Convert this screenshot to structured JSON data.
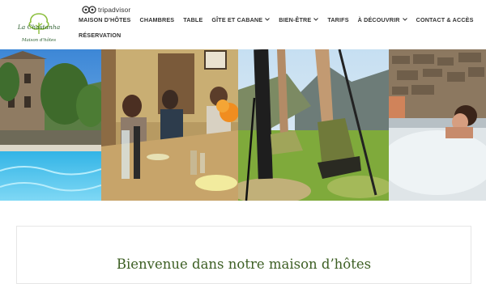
{
  "brand": {
    "name": "La Chastanha",
    "subtitle": "Maison d'hôtes"
  },
  "tripadvisor": {
    "label": "tripadvisor"
  },
  "nav": {
    "items": [
      {
        "label": "MAISON D'HÔTES",
        "dropdown": false
      },
      {
        "label": "CHAMBRES",
        "dropdown": false
      },
      {
        "label": "TABLE",
        "dropdown": false
      },
      {
        "label": "GÎTE ET CABANE",
        "dropdown": true
      },
      {
        "label": "BIEN-ÊTRE",
        "dropdown": true
      },
      {
        "label": "TARIFS",
        "dropdown": false
      },
      {
        "label": "À DÉCOUVRIR",
        "dropdown": true
      },
      {
        "label": "CONTACT & ACCÈS",
        "dropdown": false
      }
    ],
    "second_row": [
      {
        "label": "RÉSERVATION",
        "dropdown": false
      }
    ]
  },
  "banner": {
    "panels": [
      "house-and-pool",
      "dinner-table",
      "hiking-boots",
      "spa-jacuzzi"
    ]
  },
  "main": {
    "heading": "Bienvenue dans notre maison d’hôtes"
  },
  "colors": {
    "brand_green": "#3d5f24",
    "nav_text": "#333333"
  }
}
